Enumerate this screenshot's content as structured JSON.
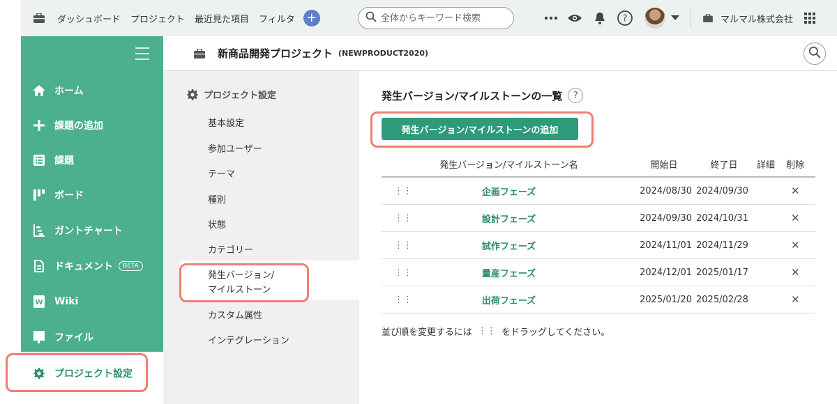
{
  "topbar": {
    "nav": [
      "ダッシュボード",
      "プロジェクト",
      "最近見た項目",
      "フィルタ"
    ],
    "search_placeholder": "全体からキーワード検索",
    "org_name": "マルマル株式会社",
    "icons": [
      "briefcase-icon",
      "plus-icon",
      "search-icon",
      "more-icon",
      "eye-icon",
      "bell-icon",
      "help-icon",
      "avatar",
      "chevron-down-icon",
      "briefcase-icon",
      "apps-grid-icon"
    ]
  },
  "sidebar": {
    "items": [
      {
        "label": "ホーム",
        "icon": "home-icon"
      },
      {
        "label": "課題の追加",
        "icon": "plus-icon"
      },
      {
        "label": "課題",
        "icon": "list-icon"
      },
      {
        "label": "ボード",
        "icon": "board-icon"
      },
      {
        "label": "ガントチャート",
        "icon": "gantt-icon"
      },
      {
        "label": "ドキュメント",
        "icon": "document-icon",
        "badge": "BETA"
      },
      {
        "label": "Wiki",
        "icon": "wiki-icon"
      },
      {
        "label": "ファイル",
        "icon": "file-icon"
      },
      {
        "label": "プロジェクト設定",
        "icon": "gear-icon",
        "active": true
      }
    ]
  },
  "project": {
    "name": "新商品開発プロジェクト",
    "key": "(NEWPRODUCT2020)"
  },
  "settings_menu": {
    "heading": "プロジェクト設定",
    "items": [
      "基本設定",
      "参加ユーザー",
      "テーマ",
      "種別",
      "状態",
      "カテゴリー",
      "発生バージョン/",
      "マイルストーン",
      "カスタム属性",
      "インテグレーション"
    ]
  },
  "main": {
    "title": "発生バージョン/マイルストーンの一覧",
    "help": "?",
    "add_button": "発生バージョン/マイルストーンの追加",
    "columns": {
      "name": "発生バージョン/マイルストーン名",
      "start": "開始日",
      "end": "終了日",
      "detail": "詳細",
      "delete": "削除"
    },
    "rows": [
      {
        "name": "企画フェーズ",
        "start": "2024/08/30",
        "end": "2024/09/30"
      },
      {
        "name": "設計フェーズ",
        "start": "2024/09/30",
        "end": "2024/10/31"
      },
      {
        "name": "試作フェーズ",
        "start": "2024/11/01",
        "end": "2024/11/29"
      },
      {
        "name": "量産フェーズ",
        "start": "2024/12/01",
        "end": "2025/01/17"
      },
      {
        "name": "出荷フェーズ",
        "start": "2025/01/20",
        "end": "2025/02/28"
      }
    ],
    "hint_before": "並び順を変更するには",
    "hint_after": "をドラッグしてください。"
  },
  "colors": {
    "sidebar": "#4caf8f",
    "accent": "#2e9a7a",
    "highlight": "#f07f6e"
  }
}
